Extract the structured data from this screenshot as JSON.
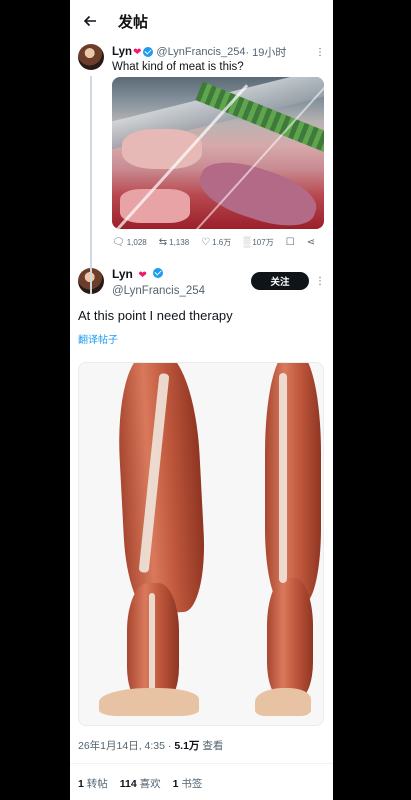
{
  "header": {
    "title": "发帖"
  },
  "quoted_tweet": {
    "name": "Lyn",
    "handle": "@LynFrancis_254",
    "time": "· 19小时",
    "text": "What kind of meat is this?",
    "stats": {
      "replies": "1,028",
      "retweets": "1,138",
      "likes": "1.6万",
      "views": "107万"
    }
  },
  "main_tweet": {
    "name": "Lyn",
    "handle": "@LynFrancis_254",
    "follow_label": "关注",
    "text": "At this point I need therapy",
    "translate_label": "翻译帖子",
    "timestamp_prefix": "26年1月14日, 4:35 · ",
    "views_count": "5.1万",
    "views_label": " 查看",
    "counts": {
      "retweets_num": "1",
      "retweets_label": " 转帖",
      "likes_num": "114",
      "likes_label": " 喜欢",
      "bookmarks_num": "1",
      "bookmarks_label": " 书签"
    }
  },
  "colors": {
    "accent": "#1d9bf0",
    "heart": "#f0196e"
  }
}
